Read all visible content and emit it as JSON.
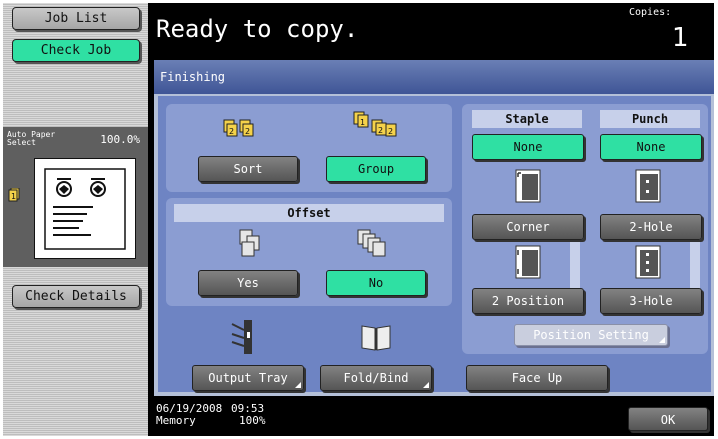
{
  "left": {
    "job_list": "Job List",
    "check_job": "Check Job",
    "preview_label_line1": "Auto Paper",
    "preview_label_line2": "Select",
    "zoom": "100.0%",
    "check_details": "Check Details"
  },
  "status": {
    "message": "Ready to copy.",
    "copies_label": "Copies:",
    "copies_value": "1"
  },
  "panel": {
    "title": "Finishing",
    "sort": "Sort",
    "group": "Group",
    "offset_label": "Offset",
    "offset_yes": "Yes",
    "offset_no": "No",
    "output_tray": "Output Tray",
    "fold_bind": "Fold/Bind",
    "staple_label": "Staple",
    "punch_label": "Punch",
    "staple_none": "None",
    "punch_none": "None",
    "corner": "Corner",
    "two_hole": "2-Hole",
    "two_position": "2 Position",
    "three_hole": "3-Hole",
    "position_setting": "Position Setting",
    "face_up": "Face Up"
  },
  "footer": {
    "date": "06/19/2008",
    "time": "09:53",
    "memory_label": "Memory",
    "memory_value": "100%",
    "ok": "OK"
  },
  "colors": {
    "selected": "#2fe0a3",
    "panel_bg": "#6e84c3",
    "section_bg": "#8b9dd2",
    "title_bar": "#3f5596"
  }
}
